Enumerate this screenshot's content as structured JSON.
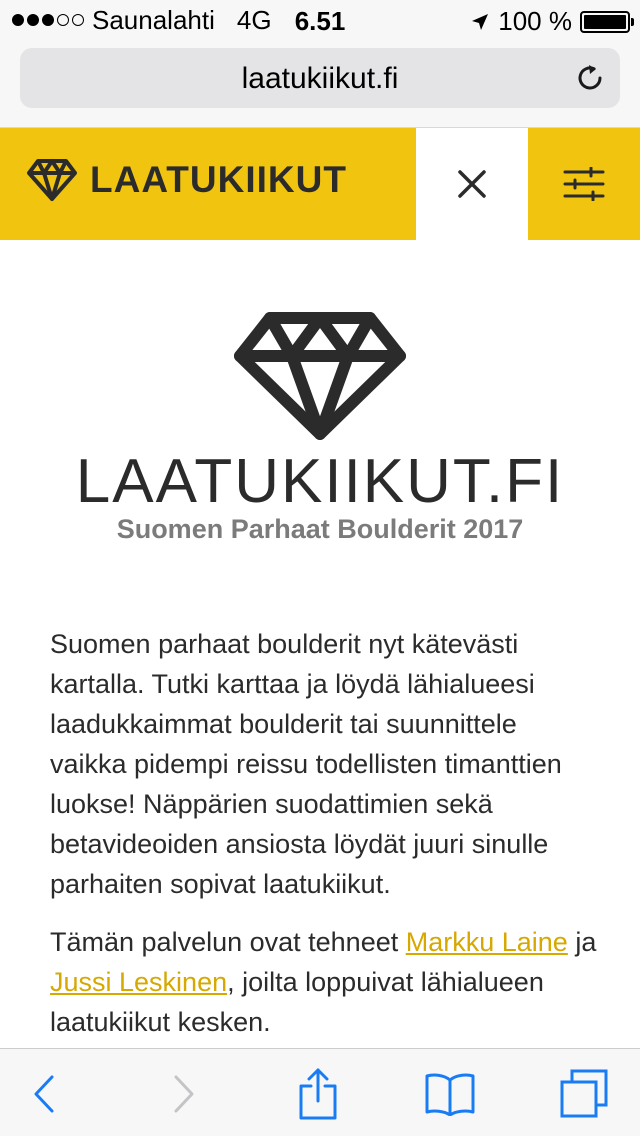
{
  "status_bar": {
    "carrier": "Saunalahti",
    "network": "4G",
    "time": "6.51",
    "battery": "100 %",
    "battery_level": 1.0,
    "signal_bars": 3,
    "signal_total": 5
  },
  "browser": {
    "url": "laatukiikut.fi"
  },
  "header": {
    "logo_text": "LAATUKIIKUT",
    "accent_color": "#f1c40f"
  },
  "hero": {
    "title": "LAATUKIIKUT.FI",
    "subtitle": "Suomen Parhaat Boulderit 2017"
  },
  "content": {
    "paragraph1": "Suomen parhaat boulderit nyt kätevästi kartalla. Tutki karttaa ja löydä lähialueesi laadukkaimmat boulderit tai suunnittele vaikka pidempi reissu todellisten timanttien luokse! Näppärien suodattimien sekä betavideoiden ansiosta löydät juuri sinulle parhaiten sopivat laatukiikut.",
    "p2_prefix": "Tämän palvelun ovat tehneet ",
    "link1": "Markku Laine",
    "p2_middle": " ja ",
    "link2": "Jussi Leskinen",
    "p2_suffix": ", joilta loppuivat lähialueen laatukiikut kesken.",
    "link_color": "#d6a800"
  },
  "icons": {
    "logo": "diamond-icon",
    "close": "close-icon",
    "menu": "sliders-icon",
    "reload": "reload-icon",
    "back": "back-icon",
    "forward": "forward-icon",
    "share": "share-icon",
    "bookmarks": "bookmarks-icon",
    "tabs": "tabs-icon"
  }
}
